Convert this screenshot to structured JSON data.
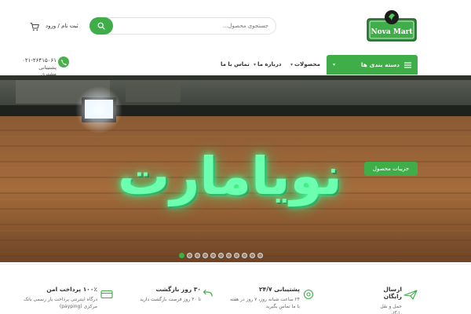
{
  "header": {
    "logo_text": "Nova Mart",
    "search_placeholder": "جستجوی محصول...",
    "auth_signup": "ثبت نام",
    "auth_separator": "/",
    "auth_login": "ورود"
  },
  "nav": {
    "categories_label": "دسته بندی ها",
    "items": [
      {
        "label": "محصولات"
      },
      {
        "label": "درباره ما"
      },
      {
        "label": "تماس با ما"
      }
    ],
    "support_phone": "۰۲۱-۲۶۴۱۵۰۶۱",
    "support_label": "پشتیبانی مشتری"
  },
  "banner": {
    "sign_text": "نویامارت",
    "details_button": "جزییات محصول",
    "slide_count": 11,
    "active_slide": 0
  },
  "features": [
    {
      "title": "ارسال رایگان",
      "desc": "حمل و نقل رایگان"
    },
    {
      "title": "پشتیبانی ۲۴/۷",
      "desc": "۲۴ ساعت شبانه روز، ۷ روز در هفته با ما تماس بگیرید"
    },
    {
      "title": "۳۰ روز بازگشت",
      "desc": "تا ۳۰ روز فرصت بازگشت دارید"
    },
    {
      "title": "۱۰۰٪ پرداخت امن",
      "desc": "درگاه اینترنتی پرداخت یار رسمی بانک مرکزی (payping)"
    }
  ],
  "colors": {
    "brand_green": "#3fae49",
    "sign_glow": "#6dffb0"
  }
}
